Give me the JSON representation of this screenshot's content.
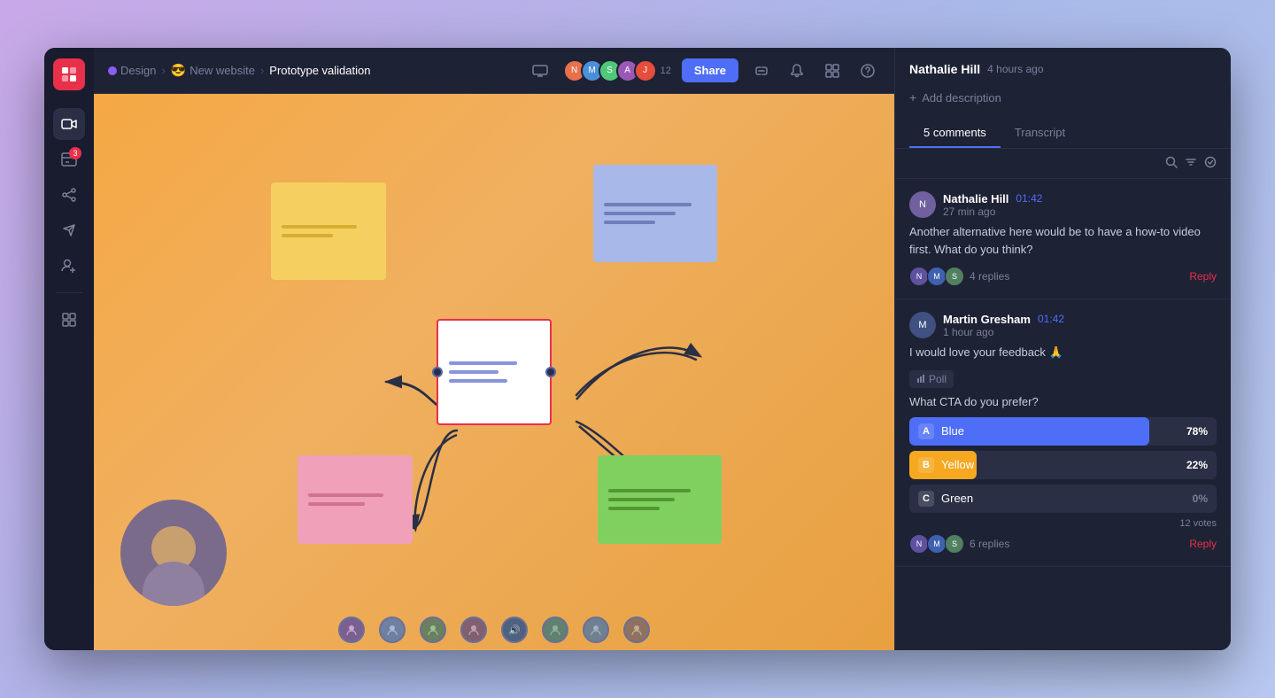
{
  "app": {
    "logo": "c/a",
    "window_title": "Prototype validation"
  },
  "breadcrumb": {
    "section": "Design",
    "project": "New website",
    "page": "Prototype validation"
  },
  "header": {
    "participant_count": "12",
    "share_label": "Share"
  },
  "sidebar": {
    "items": [
      {
        "id": "video",
        "icon": "📹",
        "badge": null
      },
      {
        "id": "inbox",
        "icon": "📥",
        "badge": "3"
      },
      {
        "id": "share",
        "icon": "🔀",
        "badge": null
      },
      {
        "id": "send",
        "icon": "✈️",
        "badge": null
      },
      {
        "id": "add-user",
        "icon": "👤",
        "badge": null
      },
      {
        "id": "grid",
        "icon": "⊞",
        "badge": null
      }
    ]
  },
  "panel": {
    "title_user": "Nathalie Hill",
    "title_time": "4 hours ago",
    "add_desc_label": "Add description",
    "tabs": [
      {
        "id": "comments",
        "label": "5 comments",
        "active": true
      },
      {
        "id": "transcript",
        "label": "Transcript",
        "active": false
      }
    ],
    "comments": [
      {
        "id": 1,
        "user": "Nathalie Hill",
        "timestamp": "01:42",
        "age": "27 min ago",
        "text": "Another alternative here would be to have a how-to video first. What do you think?",
        "replies_count": "4 replies",
        "reply_label": "Reply"
      },
      {
        "id": 2,
        "user": "Martin Gresham",
        "timestamp": "01:42",
        "age": "1 hour ago",
        "text": "I would love your feedback 🙏",
        "poll": {
          "label": "Poll",
          "question": "What CTA do you prefer?",
          "options": [
            {
              "letter": "A",
              "label": "Blue",
              "pct": 78,
              "pct_label": "78%",
              "color": "blue"
            },
            {
              "letter": "B",
              "label": "Yellow",
              "pct": 22,
              "pct_label": "22%",
              "color": "yellow"
            },
            {
              "letter": "C",
              "label": "Green",
              "pct": 0,
              "pct_label": "0%",
              "color": "green"
            }
          ],
          "votes": "12 votes"
        },
        "replies_count": "6 replies",
        "reply_label": "Reply"
      }
    ]
  }
}
